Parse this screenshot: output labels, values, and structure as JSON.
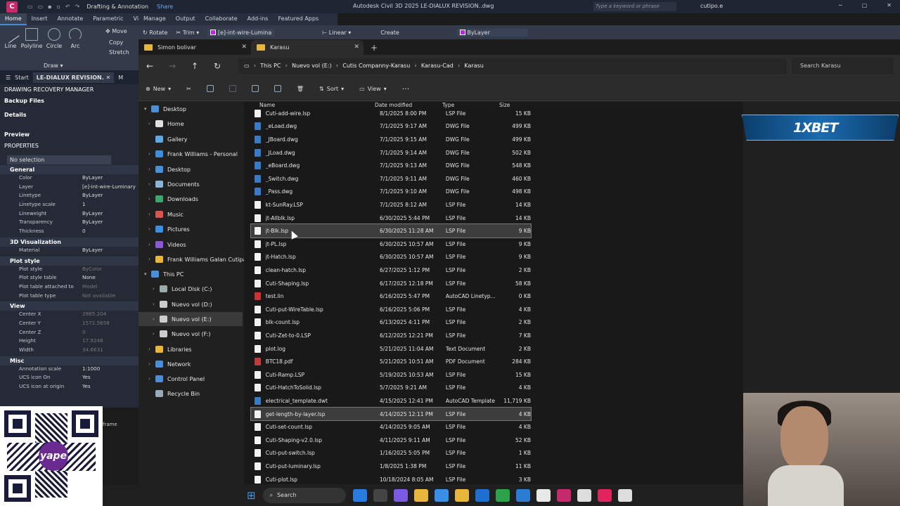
{
  "acad": {
    "logo": "C",
    "workspace": "Drafting & Annotation",
    "share": "Share",
    "title": "Autodesk Civil 3D 2025   LE-DIALUX REVISION..dwg",
    "search_placeholder": "Type a keyword or phrase",
    "user": "cutipo.e",
    "ribbon_tabs": [
      "Home",
      "Insert",
      "Annotate",
      "Parametric",
      "View",
      "Manage",
      "Output",
      "Collaborate",
      "Add-ins",
      "Featured Apps"
    ],
    "draw_tools": [
      "Line",
      "Polyline",
      "Circle",
      "Arc"
    ],
    "draw_panel": "Draw",
    "modify_tools": [
      "Move",
      "Rotate",
      "Trim",
      "Copy",
      "Stretch"
    ],
    "layer_name": "[e]-int-wire-Lumina",
    "linear_label": "Linear",
    "create_label": "Create",
    "bylayer_label": "ByLayer",
    "file_tabs": [
      "Start",
      "LE-DIALUX REVISION.",
      "M"
    ]
  },
  "drm": {
    "title": "DRAWING RECOVERY MANAGER",
    "backup": "Backup Files",
    "details": "Details",
    "preview": "Preview",
    "properties": "PROPERTIES",
    "selection": "No selection",
    "general": {
      "title": "General",
      "rows": [
        {
          "k": "Color",
          "v": "ByLayer"
        },
        {
          "k": "Layer",
          "v": "[e]-int-wire-Luminary"
        },
        {
          "k": "Linetype",
          "v": "ByLayer"
        },
        {
          "k": "Linetype scale",
          "v": "1"
        },
        {
          "k": "Lineweight",
          "v": "ByLayer"
        },
        {
          "k": "Transparency",
          "v": "ByLayer"
        },
        {
          "k": "Thickness",
          "v": "0"
        }
      ]
    },
    "viz": {
      "title": "3D Visualization",
      "rows": [
        {
          "k": "Material",
          "v": "ByLayer"
        }
      ]
    },
    "plot": {
      "title": "Plot style",
      "rows": [
        {
          "k": "Plot style",
          "v": "ByColor"
        },
        {
          "k": "Plot style table",
          "v": "None"
        },
        {
          "k": "Plot table attached to",
          "v": "Model"
        },
        {
          "k": "Plot table type",
          "v": "Not available"
        }
      ]
    },
    "view": {
      "title": "View",
      "rows": [
        {
          "k": "Center X",
          "v": "2885.204"
        },
        {
          "k": "Center Y",
          "v": "1572.5658"
        },
        {
          "k": "Center Z",
          "v": "0"
        },
        {
          "k": "Height",
          "v": "17.9246"
        },
        {
          "k": "Width",
          "v": "34.6631"
        }
      ]
    },
    "misc": {
      "title": "Misc",
      "rows": [
        {
          "k": "Annotation scale",
          "v": "1:1000"
        },
        {
          "k": "UCS icon On",
          "v": "Yes"
        },
        {
          "k": "UCS icon at origin",
          "v": "Yes"
        }
      ]
    },
    "frame_label": "frame"
  },
  "yape": "yape",
  "explorer": {
    "tabs": [
      "Simon bolivar",
      "Karasu"
    ],
    "breadcrumb": [
      "This PC",
      "Nuevo vol (E:)",
      "Cutis Companny-Karasu",
      "Karasu-Cad",
      "Karasu"
    ],
    "search_placeholder": "Search Karasu",
    "commands": {
      "new": "New",
      "sort": "Sort",
      "view": "View",
      "more": "···"
    },
    "columns": {
      "name": "Name",
      "date": "Date modified",
      "type": "Type",
      "size": "Size"
    },
    "nav": [
      {
        "label": "Desktop",
        "chev": "▾",
        "color": "#4a90d9"
      },
      {
        "label": "Home",
        "chev": "›",
        "color": "#e0e0e0"
      },
      {
        "label": "Gallery",
        "chev": "",
        "color": "#5ea8e6"
      },
      {
        "label": "Frank Williams - Personal",
        "chev": "›",
        "color": "#3c8fde"
      },
      {
        "label": "Desktop",
        "chev": "›",
        "color": "#4a90d9"
      },
      {
        "label": "Documents",
        "chev": "›",
        "color": "#8ab4d8"
      },
      {
        "label": "Downloads",
        "chev": "›",
        "color": "#3aa86b"
      },
      {
        "label": "Music",
        "chev": "›",
        "color": "#d9534f"
      },
      {
        "label": "Pictures",
        "chev": "›",
        "color": "#3c8fde"
      },
      {
        "label": "Videos",
        "chev": "›",
        "color": "#8c5ad9"
      },
      {
        "label": "Frank Williams Galan Cutipa",
        "chev": "›",
        "color": "#e8b63d"
      },
      {
        "label": "This PC",
        "chev": "▾",
        "color": "#4a90d9"
      },
      {
        "label": "Local Disk (C:)",
        "chev": "›",
        "color": "#9aa"
      },
      {
        "label": "Nuevo vol (D:)",
        "chev": "›",
        "color": "#ccc"
      },
      {
        "label": "Nuevo vol (E:)",
        "chev": "›",
        "color": "#ccc"
      },
      {
        "label": "Nuevo vol (F:)",
        "chev": "›",
        "color": "#ccc"
      },
      {
        "label": "Libraries",
        "chev": "›",
        "color": "#e8b63d"
      },
      {
        "label": "Network",
        "chev": "›",
        "color": "#4a90d9"
      },
      {
        "label": "Control Panel",
        "chev": "›",
        "color": "#4a90d9"
      },
      {
        "label": "Recycle Bin",
        "chev": "",
        "color": "#9ab"
      }
    ],
    "files": [
      {
        "name": "Cuti-add-wire.lsp",
        "date": "8/1/2025 8:00 PM",
        "type": "LSP File",
        "size": "15 KB",
        "kind": "lsp"
      },
      {
        "name": "_eLoad.dwg",
        "date": "7/1/2025 9:17 AM",
        "type": "DWG File",
        "size": "499 KB",
        "kind": "dwg"
      },
      {
        "name": "_JBoard.dwg",
        "date": "7/1/2025 9:15 AM",
        "type": "DWG File",
        "size": "499 KB",
        "kind": "dwg"
      },
      {
        "name": "_JLoad.dwg",
        "date": "7/1/2025 9:14 AM",
        "type": "DWG File",
        "size": "502 KB",
        "kind": "dwg"
      },
      {
        "name": "_eBoard.dwg",
        "date": "7/1/2025 9:13 AM",
        "type": "DWG File",
        "size": "548 KB",
        "kind": "dwg"
      },
      {
        "name": "_Switch.dwg",
        "date": "7/1/2025 9:11 AM",
        "type": "DWG File",
        "size": "460 KB",
        "kind": "dwg"
      },
      {
        "name": "_Pass.dwg",
        "date": "7/1/2025 9:10 AM",
        "type": "DWG File",
        "size": "498 KB",
        "kind": "dwg"
      },
      {
        "name": "kt-SunRay.LSP",
        "date": "7/1/2025 8:12 AM",
        "type": "LSP File",
        "size": "14 KB",
        "kind": "lsp"
      },
      {
        "name": "jt-Allblk.lsp",
        "date": "6/30/2025 5:44 PM",
        "type": "LSP File",
        "size": "14 KB",
        "kind": "lsp"
      },
      {
        "name": "jt-Blk.lsp",
        "date": "6/30/2025 11:28 AM",
        "type": "LSP File",
        "size": "9 KB",
        "kind": "lsp",
        "hl": true
      },
      {
        "name": "jt-PL.lsp",
        "date": "6/30/2025 10:57 AM",
        "type": "LSP File",
        "size": "9 KB",
        "kind": "lsp"
      },
      {
        "name": "jt-Hatch.lsp",
        "date": "6/30/2025 10:57 AM",
        "type": "LSP File",
        "size": "9 KB",
        "kind": "lsp"
      },
      {
        "name": "clean-hatch.lsp",
        "date": "6/27/2025 1:12 PM",
        "type": "LSP File",
        "size": "2 KB",
        "kind": "lsp"
      },
      {
        "name": "Cuti-Shaping.lsp",
        "date": "6/17/2025 12:18 PM",
        "type": "LSP File",
        "size": "58 KB",
        "kind": "lsp"
      },
      {
        "name": "test.lin",
        "date": "6/16/2025 5:47 PM",
        "type": "AutoCAD Linetyp...",
        "size": "0 KB",
        "kind": "lin"
      },
      {
        "name": "Cuti-put-WireTable.lsp",
        "date": "6/16/2025 5:06 PM",
        "type": "LSP File",
        "size": "4 KB",
        "kind": "lsp"
      },
      {
        "name": "blk-count.lsp",
        "date": "6/13/2025 4:11 PM",
        "type": "LSP File",
        "size": "2 KB",
        "kind": "lsp"
      },
      {
        "name": "Cuti-Zet-to-0.LSP",
        "date": "6/12/2025 12:21 PM",
        "type": "LSP File",
        "size": "7 KB",
        "kind": "lsp"
      },
      {
        "name": "plot.log",
        "date": "5/21/2025 11:04 AM",
        "type": "Text Document",
        "size": "2 KB",
        "kind": "lsp"
      },
      {
        "name": "BTC18.pdf",
        "date": "5/21/2025 10:51 AM",
        "type": "PDF Document",
        "size": "284 KB",
        "kind": "pdf"
      },
      {
        "name": "Cuti-Ramp.LSP",
        "date": "5/19/2025 10:53 AM",
        "type": "LSP File",
        "size": "15 KB",
        "kind": "lsp"
      },
      {
        "name": "Cuti-HatchToSolid.lsp",
        "date": "5/7/2025 9:21 AM",
        "type": "LSP File",
        "size": "4 KB",
        "kind": "lsp"
      },
      {
        "name": "electrical_template.dwt",
        "date": "4/15/2025 12:41 PM",
        "type": "AutoCAD Template",
        "size": "11,719 KB",
        "kind": "dwg"
      },
      {
        "name": "get-length-by-layer.lsp",
        "date": "4/14/2025 12:11 PM",
        "type": "LSP File",
        "size": "4 KB",
        "kind": "lsp",
        "sel": true
      },
      {
        "name": "Cuti-set-count.lsp",
        "date": "4/14/2025 9:05 AM",
        "type": "LSP File",
        "size": "4 KB",
        "kind": "lsp"
      },
      {
        "name": "Cuti-Shaping-v2.0.lsp",
        "date": "4/11/2025 9:11 AM",
        "type": "LSP File",
        "size": "52 KB",
        "kind": "lsp"
      },
      {
        "name": "Cuti-put-switch.lsp",
        "date": "1/16/2025 5:05 PM",
        "type": "LSP File",
        "size": "1 KB",
        "kind": "lsp"
      },
      {
        "name": "Cuti-put-luminary.lsp",
        "date": "1/8/2025 1:38 PM",
        "type": "LSP File",
        "size": "11 KB",
        "kind": "lsp"
      },
      {
        "name": "Cuti-plot.lsp",
        "date": "10/18/2024 8:05 AM",
        "type": "LSP File",
        "size": "3 KB",
        "kind": "lsp"
      }
    ]
  },
  "banner": "1XBET",
  "taskbar": {
    "search": "Search",
    "apps": [
      "#2a7be0",
      "#444",
      "#7a5ae0",
      "#e8b63d",
      "#3a8ee6",
      "#e8b63d",
      "#1e6fd0",
      "#2ca24a",
      "#2b7cd3",
      "#e8e8e8",
      "#c62a6b",
      "#ddd",
      "#e0245e",
      "#ddd"
    ]
  },
  "colors": {
    "accent": "#4a8ad4",
    "folder": "#e8b63d",
    "bylayer": "#c020f0"
  }
}
